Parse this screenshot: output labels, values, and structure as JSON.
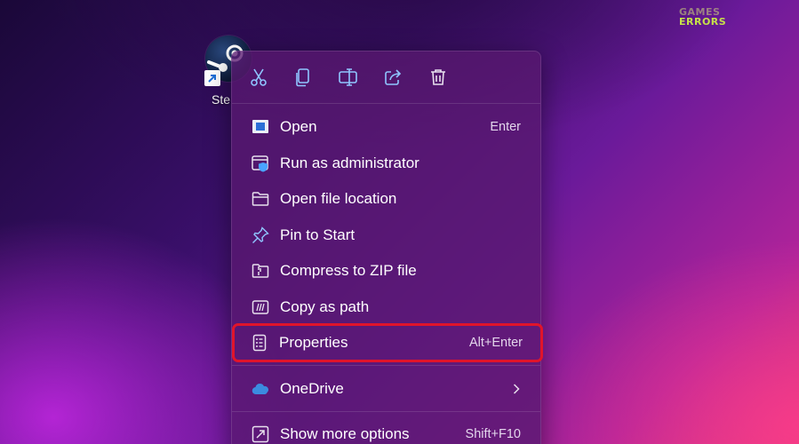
{
  "watermark": {
    "line1": "GAMES",
    "line2": "ERRORS"
  },
  "desktop_icon": {
    "label": "Ste",
    "icon": "steam-icon"
  },
  "toolbar": [
    {
      "name": "cut",
      "icon": "scissors-icon"
    },
    {
      "name": "copy",
      "icon": "copy-icon"
    },
    {
      "name": "rename",
      "icon": "rename-icon"
    },
    {
      "name": "share",
      "icon": "share-icon"
    },
    {
      "name": "delete",
      "icon": "trash-icon"
    }
  ],
  "menu": {
    "items": [
      {
        "label": "Open",
        "shortcut": "Enter",
        "icon": "open-icon"
      },
      {
        "label": "Run as administrator",
        "shortcut": "",
        "icon": "shield-window-icon"
      },
      {
        "label": "Open file location",
        "shortcut": "",
        "icon": "folder-icon"
      },
      {
        "label": "Pin to Start",
        "shortcut": "",
        "icon": "pin-icon"
      },
      {
        "label": "Compress to ZIP file",
        "shortcut": "",
        "icon": "zip-folder-icon"
      },
      {
        "label": "Copy as path",
        "shortcut": "",
        "icon": "path-icon"
      },
      {
        "label": "Properties",
        "shortcut": "Alt+Enter",
        "icon": "properties-icon"
      },
      {
        "label": "OneDrive",
        "shortcut": "",
        "icon": "cloud-icon"
      },
      {
        "label": "Show more options",
        "shortcut": "Shift+F10",
        "icon": "more-options-icon"
      }
    ]
  },
  "colors": {
    "highlight_border": "#e0142b",
    "accent": "#5aa8ff",
    "onedrive": "#3b8be0"
  }
}
